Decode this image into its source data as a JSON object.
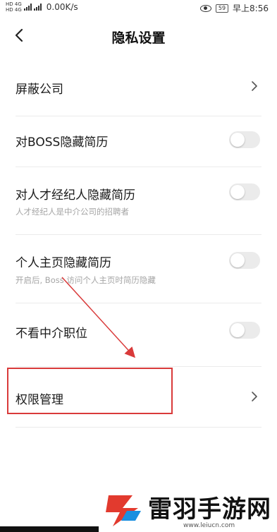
{
  "statusbar": {
    "left_tiny_1": "HD 4G",
    "left_tiny_2": "HD 4G",
    "net_speed": "0.00K/s",
    "battery": "59",
    "time": "早上8:56",
    "icons": [
      "hd-icon",
      "signal-icon",
      "signal-icon",
      "eye-icon",
      "battery-icon"
    ]
  },
  "navbar": {
    "title": "隐私设置",
    "back_icon": "chevron-left-icon"
  },
  "settings": [
    {
      "label": "屏蔽公司",
      "control": "chevron"
    },
    {
      "label": "对BOSS隐藏简历",
      "control": "toggle",
      "on": false
    },
    {
      "label": "对人才经纪人隐藏简历",
      "sub": "人才经纪人是中介公司的招聘者",
      "control": "toggle",
      "on": false
    },
    {
      "label": "个人主页隐藏简历",
      "sub": "开启后, Boss 访问个人主页时简历隐藏",
      "control": "toggle",
      "on": false
    },
    {
      "label": "不看中介职位",
      "control": "toggle",
      "on": false
    },
    {
      "label": "权限管理",
      "control": "chevron"
    }
  ],
  "annotation": {
    "color": "#d93a3a"
  },
  "watermark": {
    "text": "雷羽手游网",
    "url": "www.leiucn.com",
    "logo_colors": [
      "#e23a2e",
      "#1a8fe0"
    ]
  }
}
